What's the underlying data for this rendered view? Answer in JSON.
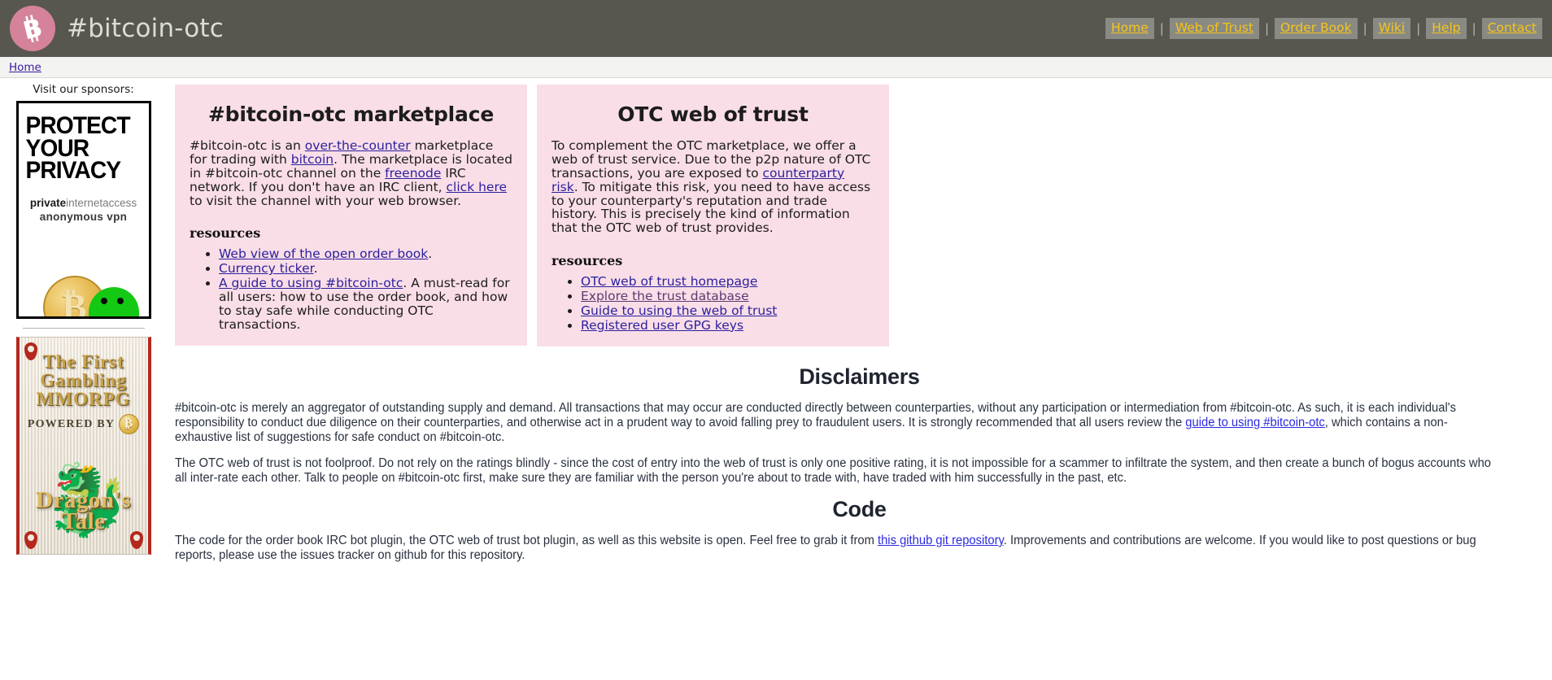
{
  "header": {
    "logo_icon": "bitcoin-logo-icon",
    "title": "#bitcoin-otc",
    "nav": [
      {
        "label": "Home"
      },
      {
        "label": "Web of Trust"
      },
      {
        "label": "Order Book"
      },
      {
        "label": "Wiki"
      },
      {
        "label": "Help"
      },
      {
        "label": "Contact"
      }
    ],
    "nav_separator": "|",
    "colors": {
      "bar": "#575750",
      "link": "#f5c518",
      "chip": "#8a8a84"
    }
  },
  "breadcrumb": {
    "items": [
      {
        "label": "Home"
      }
    ]
  },
  "sidebar": {
    "sponsors_label": "Visit our sponsors:",
    "ads": [
      {
        "name": "private-internet-access",
        "line1": "PROTECT",
        "line2": "YOUR",
        "line3": "PRIVACY",
        "brand_bold": "private",
        "brand_rest": "internetaccess",
        "brand_sub": "anonymous vpn"
      },
      {
        "name": "dragons-tale",
        "t1": "The First",
        "t2": "Gambling",
        "t3": "MMORPG",
        "powered": "POWERED BY",
        "logo_l1": "Dragon's",
        "logo_l2": "Tale"
      }
    ]
  },
  "main": {
    "marketplace": {
      "heading": "#bitcoin-otc marketplace",
      "intro": {
        "s1": "#bitcoin-otc is an ",
        "l1": "over-the-counter",
        "s2": " marketplace for trading with ",
        "l2": "bitcoin",
        "s3": ". The marketplace is located in #bitcoin-otc channel on the ",
        "l3": "freenode",
        "s4": " IRC network. If you don't have an IRC client, ",
        "l4": "click here",
        "s5": " to visit the channel with your web browser."
      },
      "resources_heading": "resources",
      "resources": [
        {
          "link": "Web view of the open order book",
          "after": "."
        },
        {
          "link": "Currency ticker",
          "after": "."
        },
        {
          "link": "A guide to using #bitcoin-otc",
          "after": ". A must-read for all users: how to use the order book, and how to stay safe while conducting OTC transactions."
        }
      ]
    },
    "webtrust": {
      "heading": "OTC web of trust",
      "intro": {
        "s1": "To complement the OTC marketplace, we offer a web of trust service. Due to the p2p nature of OTC transactions, you are exposed to ",
        "l1": "counterparty risk",
        "s2": ". To mitigate this risk, you need to have access to your counterparty's reputation and trade history. This is precisely the kind of information that the OTC web of trust provides."
      },
      "resources_heading": "resources",
      "resources": [
        {
          "link": "OTC web of trust homepage",
          "visited": false
        },
        {
          "link": "Explore the trust database",
          "visited": true
        },
        {
          "link": "Guide to using the web of trust",
          "visited": false
        },
        {
          "link": "Registered user GPG keys",
          "visited": false
        }
      ]
    },
    "disclaimers": {
      "heading": "Disclaimers",
      "p1_a": "#bitcoin-otc is merely an aggregator of outstanding supply and demand. All transactions that may occur are conducted directly between counterparties, without any participation or intermediation from #bitcoin-otc. As such, it is each individual's responsibility to conduct due diligence on their counterparties, and otherwise act in a prudent way to avoid falling prey to fraudulent users. It is strongly recommended that all users review the ",
      "p1_link": "guide to using #bitcoin-otc",
      "p1_b": ", which contains a non-exhaustive list of suggestions for safe conduct on #bitcoin-otc.",
      "p2": "The OTC web of trust is not foolproof. Do not rely on the ratings blindly - since the cost of entry into the web of trust is only one positive rating, it is not impossible for a scammer to infiltrate the system, and then create a bunch of bogus accounts who all inter-rate each other. Talk to people on #bitcoin-otc first, make sure they are familiar with the person you're about to trade with, have traded with him successfully in the past, etc."
    },
    "code": {
      "heading": "Code",
      "p_a": "The code for the order book IRC bot plugin, the OTC web of trust bot plugin, as well as this website is open. Feel free to grab it from ",
      "p_link": "this github git repository",
      "p_b": ". Improvements and contributions are welcome. If you would like to post questions or bug reports, please use the issues tracker on github for this repository."
    }
  }
}
